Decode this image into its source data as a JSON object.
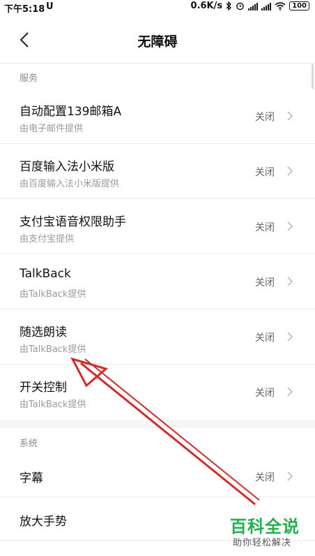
{
  "status_bar": {
    "time": "下午5:18",
    "notification_icon": "U",
    "net_speed": "0.6K/s",
    "battery": "100",
    "icons": [
      "bluetooth-icon",
      "alarm-icon",
      "signal-icon",
      "signal-icon",
      "wifi-icon",
      "battery-icon"
    ]
  },
  "header": {
    "title": "无障碍",
    "back_icon": "chevron-left-icon"
  },
  "sections": [
    {
      "label": "服务",
      "items": [
        {
          "title": "自动配置139邮箱A",
          "subtitle": "由电子邮件提供",
          "value": "关闭"
        },
        {
          "title": "百度输入法小米版",
          "subtitle": "由百度输入法小米版提供",
          "value": "关闭"
        },
        {
          "title": "支付宝语音权限助手",
          "subtitle": "由支付宝提供",
          "value": "关闭"
        },
        {
          "title": "TalkBack",
          "subtitle": "由TalkBack提供",
          "value": "关闭"
        },
        {
          "title": "随选朗读",
          "subtitle": "由TalkBack提供",
          "value": "关闭"
        },
        {
          "title": "开关控制",
          "subtitle": "由TalkBack提供",
          "value": "关闭"
        }
      ]
    },
    {
      "label": "系统",
      "items": [
        {
          "title": "字幕",
          "value": "关闭"
        },
        {
          "title": "放大手势"
        }
      ]
    }
  ],
  "watermark": {
    "title": "百科全说",
    "subtitle": "助你轻松解决"
  },
  "annotation": {
    "type": "red-arrow",
    "color": "#d42a2a"
  }
}
